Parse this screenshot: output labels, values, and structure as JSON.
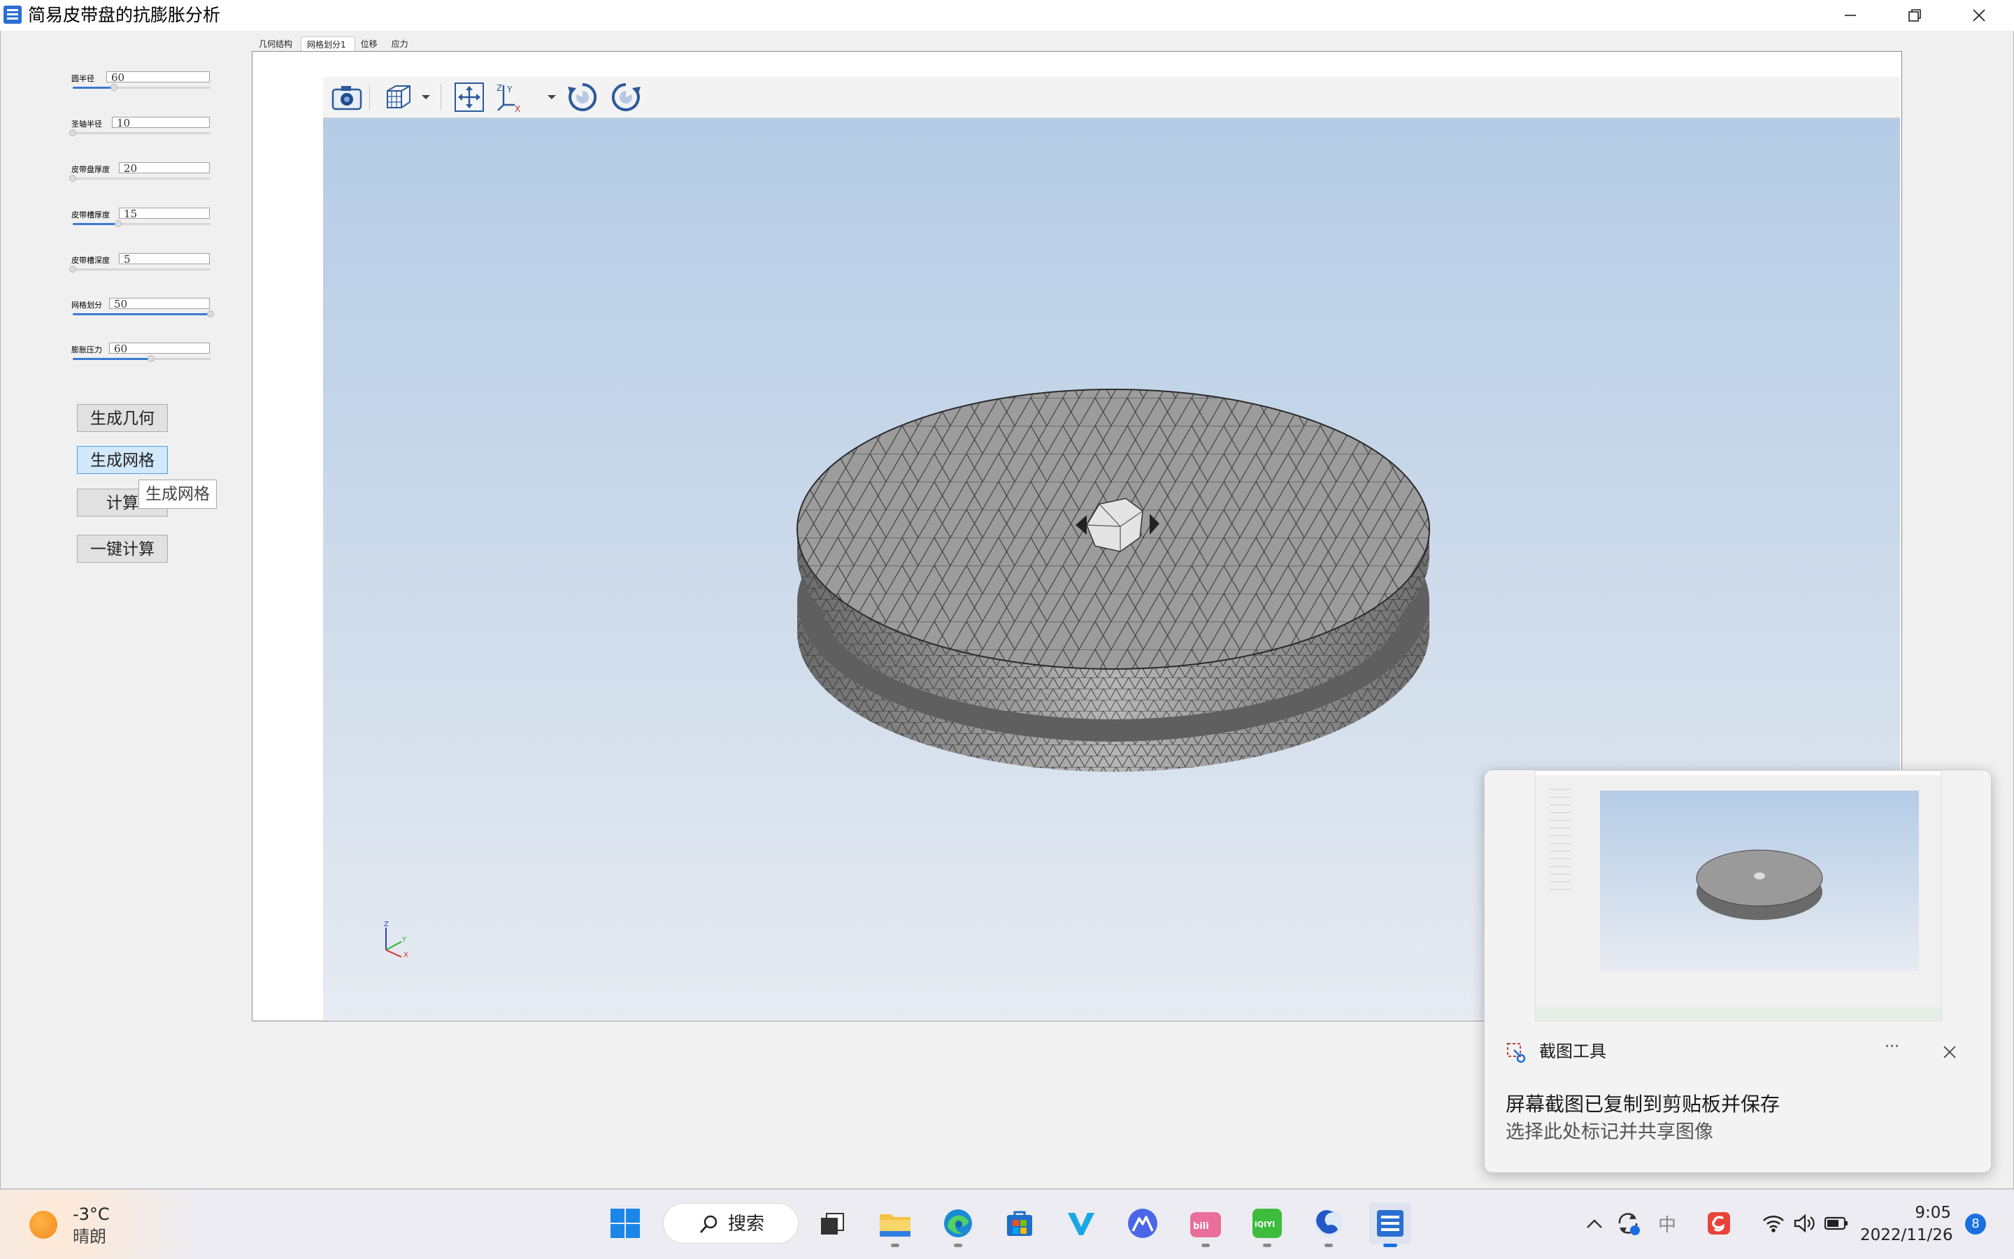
{
  "window": {
    "title": "简易皮带盘的抗膨胀分析"
  },
  "params": [
    {
      "label": "圆半径",
      "value": "60",
      "level": 0.3
    },
    {
      "label": "圣轴半径",
      "value": "10",
      "level": 0.0
    },
    {
      "label": "皮带盘厚度",
      "value": "20",
      "level": 0.0
    },
    {
      "label": "皮带槽厚度",
      "value": "15",
      "level": 0.33
    },
    {
      "label": "皮带槽深度",
      "value": "5",
      "level": 0.0
    },
    {
      "label": "网格划分",
      "value": "50",
      "level": 1.0
    },
    {
      "label": "膨胀压力",
      "value": "60",
      "level": 0.57
    }
  ],
  "buttons": {
    "gen_geometry": "生成几何",
    "gen_mesh": "生成网格",
    "compute": "计算",
    "one_click": "一键计算",
    "tooltip": "生成网格"
  },
  "tabs": [
    "几何结构",
    "网格划分1",
    "位移",
    "应力"
  ],
  "active_tab": 1,
  "toast": {
    "app": "截图工具",
    "title": "屏幕截图已复制到剪贴板并保存",
    "body": "选择此处标记并共享图像",
    "more": "···"
  },
  "taskbar": {
    "weather_temp": "-3°C",
    "weather_desc": "晴朗",
    "search": "搜索",
    "time": "9:05",
    "date": "2022/11/26",
    "notifications": "8",
    "ime": "中"
  },
  "axes_labels": {
    "x": "X",
    "y": "Y",
    "z": "Z"
  }
}
